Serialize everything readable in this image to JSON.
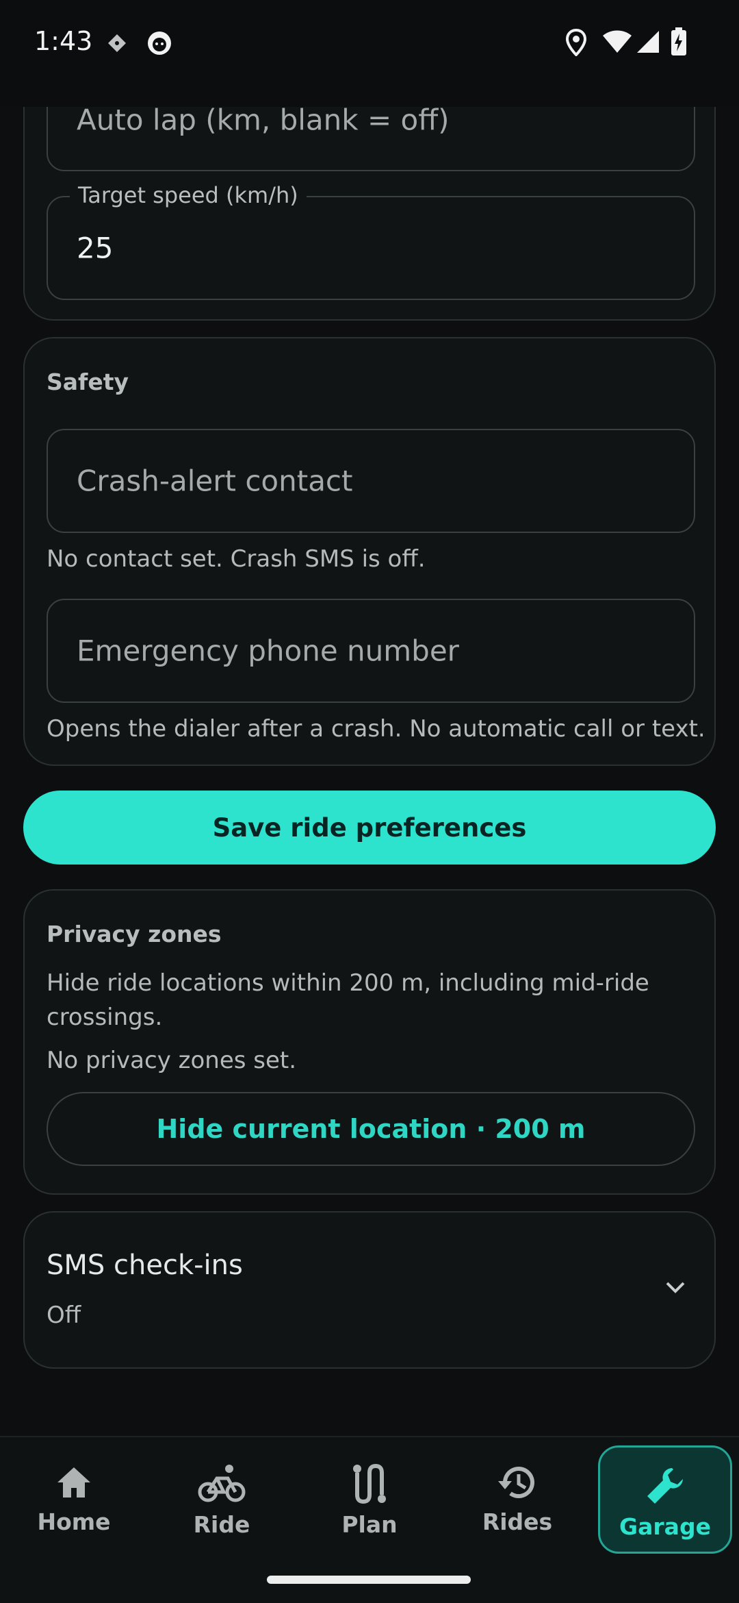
{
  "status_bar": {
    "time": "1:43"
  },
  "ride_settings": {
    "auto_lap_placeholder": "Auto lap (km, blank = off)",
    "target_speed_label": "Target speed (km/h)",
    "target_speed_value": "25"
  },
  "safety": {
    "title": "Safety",
    "crash_contact_placeholder": "Crash-alert contact",
    "crash_contact_helper": "No contact set. Crash SMS is off.",
    "emergency_phone_placeholder": "Emergency phone number",
    "emergency_phone_helper": "Opens the dialer after a crash. No automatic call or text."
  },
  "save_button_label": "Save ride preferences",
  "privacy_zones": {
    "title": "Privacy zones",
    "description": "Hide ride locations within 200 m, including mid-ride crossings.",
    "status": "No privacy zones set.",
    "hide_button_label": "Hide current location · 200 m"
  },
  "sms_checkins": {
    "title": "SMS check-ins",
    "status": "Off"
  },
  "bottom_nav": {
    "items": [
      {
        "label": "Home",
        "icon": "home-icon"
      },
      {
        "label": "Ride",
        "icon": "bike-icon"
      },
      {
        "label": "Plan",
        "icon": "route-icon"
      },
      {
        "label": "Rides",
        "icon": "history-icon"
      },
      {
        "label": "Garage",
        "icon": "wrench-icon",
        "active": true
      }
    ]
  },
  "colors": {
    "accent": "#2ee3ce",
    "background": "#0c0e0f",
    "card": "#111415"
  }
}
